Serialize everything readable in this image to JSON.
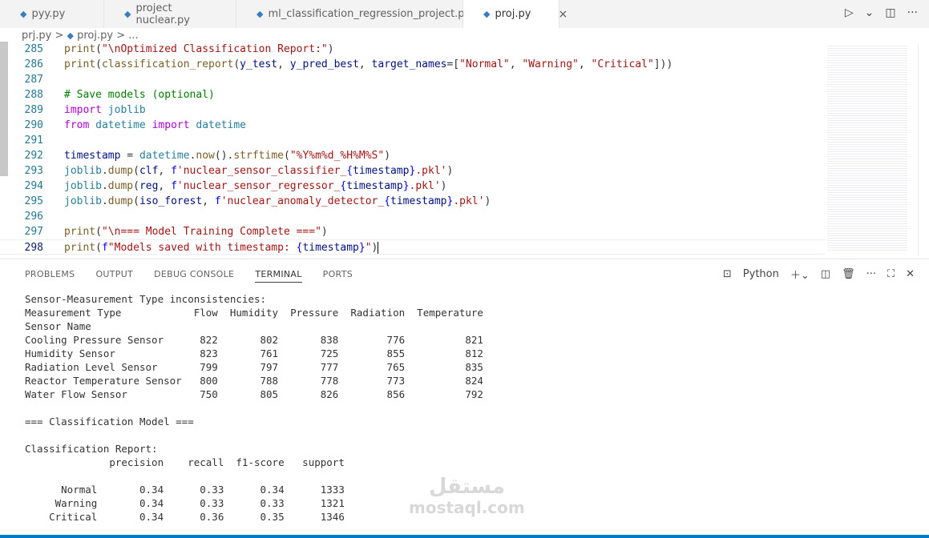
{
  "tabs": [
    {
      "label": "pyy.py"
    },
    {
      "label": "project nuclear.py"
    },
    {
      "label": "ml_classification_regression_project.py"
    },
    {
      "label": "proj.py",
      "active": true
    }
  ],
  "tab_actions": {
    "run": "▷",
    "run_menu": "⌄",
    "split": "◫",
    "more": "···",
    "close": "×"
  },
  "breadcrumb": {
    "folder": "prj.py",
    "sep": ">",
    "file": "proj.py",
    "rest": "> ..."
  },
  "code": [
    {
      "n": "285",
      "t": [
        [
          "print",
          "f"
        ],
        [
          "(",
          "p"
        ],
        [
          "\"\\nOptimized Classification Report:\"",
          "s"
        ],
        [
          ")",
          "p"
        ]
      ]
    },
    {
      "n": "286",
      "t": [
        [
          "print",
          "f"
        ],
        [
          "(",
          "p"
        ],
        [
          "classification_report",
          "f"
        ],
        [
          "(",
          "p"
        ],
        [
          "y_test",
          "v"
        ],
        [
          ", ",
          "p"
        ],
        [
          "y_pred_best",
          "v"
        ],
        [
          ", ",
          "p"
        ],
        [
          "target_names",
          "v"
        ],
        [
          "=[",
          "p"
        ],
        [
          "\"Normal\"",
          "s"
        ],
        [
          ", ",
          "p"
        ],
        [
          "\"Warning\"",
          "s"
        ],
        [
          ", ",
          "p"
        ],
        [
          "\"Critical\"",
          "s"
        ],
        [
          "]))",
          "p"
        ]
      ]
    },
    {
      "n": "287",
      "t": []
    },
    {
      "n": "288",
      "t": [
        [
          "# Save models (optional)",
          "c"
        ]
      ]
    },
    {
      "n": "289",
      "t": [
        [
          "import ",
          "k"
        ],
        [
          "joblib",
          "t"
        ]
      ]
    },
    {
      "n": "290",
      "t": [
        [
          "from ",
          "k"
        ],
        [
          "datetime ",
          "t"
        ],
        [
          "import ",
          "k"
        ],
        [
          "datetime",
          "t"
        ]
      ]
    },
    {
      "n": "291",
      "t": []
    },
    {
      "n": "292",
      "t": [
        [
          "timestamp",
          "v"
        ],
        [
          " = ",
          "p"
        ],
        [
          "datetime",
          "t"
        ],
        [
          ".",
          "p"
        ],
        [
          "now",
          "f"
        ],
        [
          "().",
          "p"
        ],
        [
          "strftime",
          "f"
        ],
        [
          "(",
          "p"
        ],
        [
          "\"%Y%m%d_%H%M%S\"",
          "s"
        ],
        [
          ")",
          "p"
        ]
      ]
    },
    {
      "n": "293",
      "t": [
        [
          "joblib",
          "t"
        ],
        [
          ".",
          "p"
        ],
        [
          "dump",
          "f"
        ],
        [
          "(",
          "p"
        ],
        [
          "clf",
          "v"
        ],
        [
          ", ",
          "p"
        ],
        [
          "f",
          "b"
        ],
        [
          "'nuclear_sensor_classifier_",
          "s"
        ],
        [
          "{",
          "b"
        ],
        [
          "timestamp",
          "v"
        ],
        [
          "}",
          "b"
        ],
        [
          ".pkl'",
          "s"
        ],
        [
          ")",
          "p"
        ]
      ]
    },
    {
      "n": "294",
      "t": [
        [
          "joblib",
          "t"
        ],
        [
          ".",
          "p"
        ],
        [
          "dump",
          "f"
        ],
        [
          "(",
          "p"
        ],
        [
          "reg",
          "v"
        ],
        [
          ", ",
          "p"
        ],
        [
          "f",
          "b"
        ],
        [
          "'nuclear_sensor_regressor_",
          "s"
        ],
        [
          "{",
          "b"
        ],
        [
          "timestamp",
          "v"
        ],
        [
          "}",
          "b"
        ],
        [
          ".pkl'",
          "s"
        ],
        [
          ")",
          "p"
        ]
      ]
    },
    {
      "n": "295",
      "t": [
        [
          "joblib",
          "t"
        ],
        [
          ".",
          "p"
        ],
        [
          "dump",
          "f"
        ],
        [
          "(",
          "p"
        ],
        [
          "iso_forest",
          "v"
        ],
        [
          ", ",
          "p"
        ],
        [
          "f",
          "b"
        ],
        [
          "'nuclear_anomaly_detector_",
          "s"
        ],
        [
          "{",
          "b"
        ],
        [
          "timestamp",
          "v"
        ],
        [
          "}",
          "b"
        ],
        [
          ".pkl'",
          "s"
        ],
        [
          ")",
          "p"
        ]
      ]
    },
    {
      "n": "296",
      "t": []
    },
    {
      "n": "297",
      "t": [
        [
          "print",
          "f"
        ],
        [
          "(",
          "p"
        ],
        [
          "\"\\n=== Model Training Complete ===\"",
          "s"
        ],
        [
          ")",
          "p"
        ]
      ]
    },
    {
      "n": "298",
      "t": [
        [
          "print",
          "f"
        ],
        [
          "(",
          "p"
        ],
        [
          "f",
          "b"
        ],
        [
          "\"Models saved with timestamp: ",
          "s"
        ],
        [
          "{",
          "b"
        ],
        [
          "timestamp",
          "v"
        ],
        [
          "}",
          "b"
        ],
        [
          "\"",
          "s"
        ],
        [
          ")",
          "p"
        ]
      ],
      "current": true
    }
  ],
  "panel": {
    "tabs": [
      "PROBLEMS",
      "OUTPUT",
      "DEBUG CONSOLE",
      "TERMINAL",
      "PORTS"
    ],
    "active": "TERMINAL",
    "terminal_name": "Python"
  },
  "terminal": [
    "Sensor-Measurement Type inconsistencies:",
    "Measurement Type            Flow  Humidity  Pressure  Radiation  Temperature",
    "Sensor Name",
    "Cooling Pressure Sensor      822       802       838        776          821",
    "Humidity Sensor              823       761       725        855          812",
    "Radiation Level Sensor       799       797       777        765          835",
    "Reactor Temperature Sensor   800       788       778        773          824",
    "Water Flow Sensor            750       805       826        856          792",
    "",
    "=== Classification Model ===",
    "",
    "Classification Report:",
    "              precision    recall  f1-score   support",
    "",
    "      Normal       0.34      0.33      0.34      1333",
    "     Warning       0.34      0.33      0.33      1321",
    "    Critical       0.34      0.36      0.35      1346"
  ],
  "watermark": {
    "arabic": "مستقل",
    "latin": "mostaql.com"
  }
}
